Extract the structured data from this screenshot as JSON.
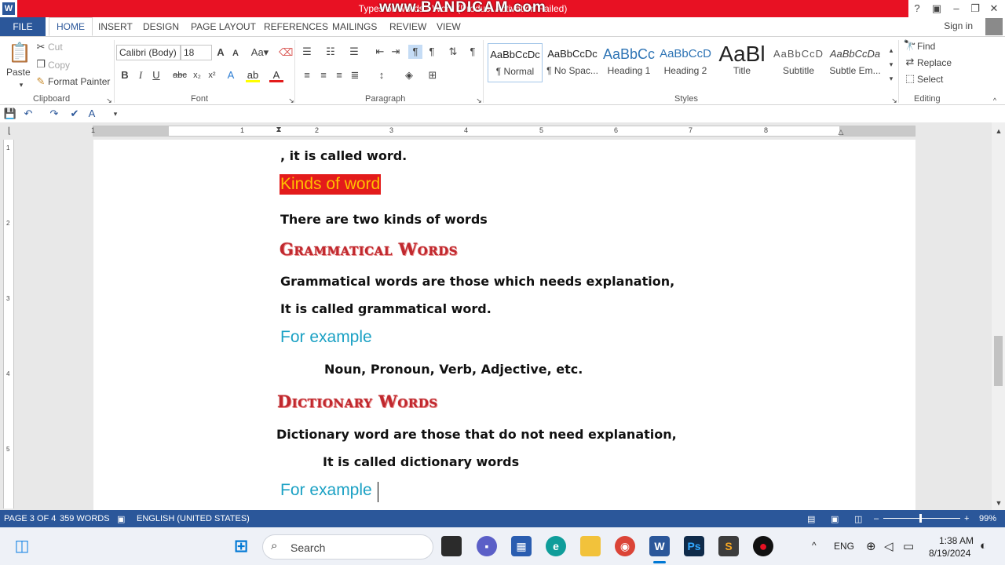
{
  "titlebar": {
    "doc_title": "Types of Words - Word (Product Activation Failed)",
    "watermark": "www.BANDICAM.com",
    "help": "?",
    "buttons": [
      "restore-ribbon",
      "minimize",
      "maximize",
      "close"
    ]
  },
  "tabs": {
    "file": "FILE",
    "items": [
      "HOME",
      "INSERT",
      "DESIGN",
      "PAGE LAYOUT",
      "REFERENCES",
      "MAILINGS",
      "REVIEW",
      "VIEW"
    ],
    "signin": "Sign in"
  },
  "ribbon": {
    "clipboard": {
      "paste": "Paste",
      "cut": "Cut",
      "copy": "Copy",
      "format_painter": "Format Painter",
      "label": "Clipboard"
    },
    "font": {
      "family": "Calibri (Body)",
      "size": "18",
      "label": "Font"
    },
    "paragraph": {
      "label": "Paragraph"
    },
    "styles": {
      "label": "Styles",
      "items": [
        {
          "preview": "AaBbCcDc",
          "name": "¶ Normal"
        },
        {
          "preview": "AaBbCcDc",
          "name": "¶ No Spac..."
        },
        {
          "preview": "AaBbCc",
          "name": "Heading 1"
        },
        {
          "preview": "AaBbCcD",
          "name": "Heading 2"
        },
        {
          "preview": "AaBl",
          "name": "Title"
        },
        {
          "preview": "AaBbCcD",
          "name": "Subtitle"
        },
        {
          "preview": "AaBbCcDa",
          "name": "Subtle Em..."
        }
      ]
    },
    "editing": {
      "find": "Find",
      "replace": "Replace",
      "select": "Select",
      "label": "Editing"
    }
  },
  "ruler": {
    "numbers": [
      "1",
      "1",
      "2",
      "3",
      "4",
      "5",
      "6",
      "7",
      "8"
    ]
  },
  "vruler": {
    "numbers": [
      "1",
      "2",
      "3",
      "4",
      "5"
    ]
  },
  "document": {
    "line1": ", it is called word.",
    "kinds_heading": "Kinds of word",
    "line2": "There are two kinds of words",
    "grammatical_heading": "Grammatical Words",
    "grammatical_def": "Grammatical words are those which needs explanation,",
    "grammatical_called": "It is called grammatical word.",
    "example1": "For example",
    "example1_items": "Noun, Pronoun, Verb, Adjective, etc.",
    "dictionary_heading": "Dictionary Words",
    "dictionary_def": "Dictionary word are those that do not need explanation,",
    "dictionary_called": "It is called dictionary words",
    "example2": "For example"
  },
  "status": {
    "page": "PAGE 3 OF 4",
    "words": "359 WORDS",
    "language": "ENGLISH (UNITED STATES)",
    "zoom": "99%"
  },
  "taskbar": {
    "search_placeholder": "Search",
    "language": "ENG",
    "time": "1:38 AM",
    "date": "8/19/2024"
  },
  "colors": {
    "word_blue": "#2b579a",
    "title_red": "#e81123",
    "heading_red": "#c0282e",
    "example_cyan": "#1ba1c4",
    "highlight_red": "#e31b1b",
    "highlight_text": "#ffc000"
  }
}
